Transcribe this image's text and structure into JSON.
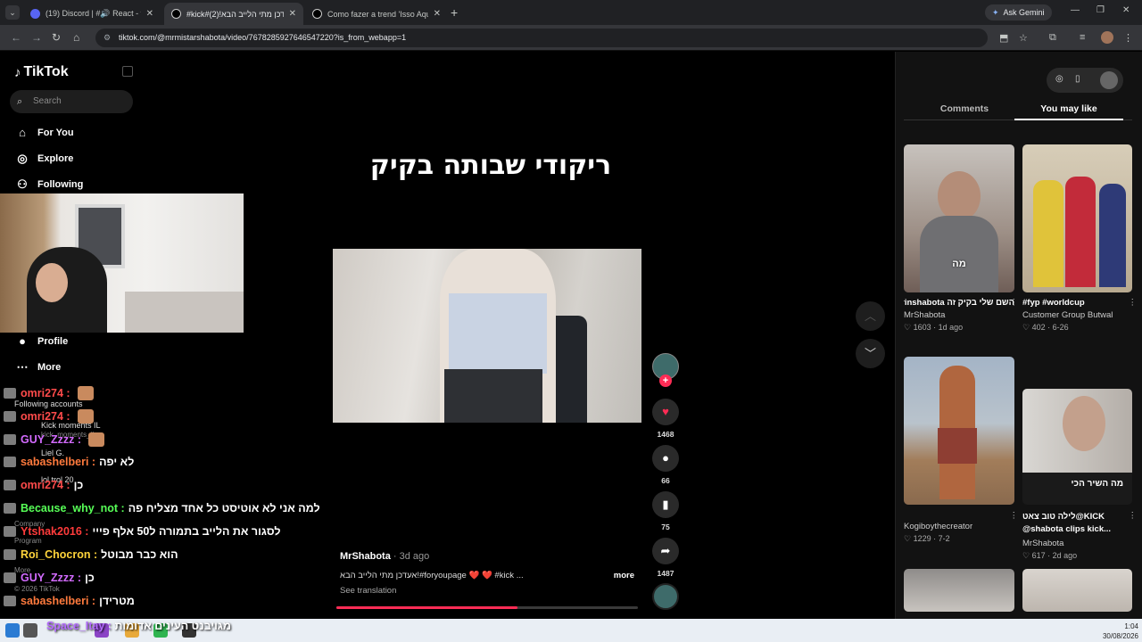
{
  "browser": {
    "tabs": [
      {
        "title": "(19) Discord | #🔊 React - t",
        "active": false,
        "favicon_color": "#5865f2"
      },
      {
        "title": "#kick#אעדכן מתי הלייב הבא!(2)",
        "active": true,
        "favicon_color": "#000000"
      },
      {
        "title": "Como fazer a trend 'Isso Aqui É",
        "active": false,
        "favicon_color": "#000000"
      }
    ],
    "url": "tiktok.com/@mrmistarshabota/video/7678285927646547220?is_from_webapp=1",
    "ask_gemini": "Ask Gemini"
  },
  "sidebar": {
    "logo": "TikTok",
    "search_placeholder": "Search",
    "nav": [
      {
        "label": "For You",
        "icon": "home-icon"
      },
      {
        "label": "Explore",
        "icon": "compass-icon"
      },
      {
        "label": "Following",
        "icon": "users-icon"
      },
      {
        "label": "Profile",
        "icon": "avatar-icon"
      },
      {
        "label": "More",
        "icon": "ellipsis-icon"
      }
    ],
    "following_header": "Following accounts",
    "following": [
      "Kick moments IL",
      "kick_moments_il",
      "Liel G.",
      "lol trol 20"
    ],
    "footer": [
      "Company",
      "Program",
      "More",
      "© 2026 TikTok"
    ]
  },
  "chat": [
    {
      "user": "omri274",
      "msg": "",
      "color": "#ff4b4b",
      "emote": true
    },
    {
      "user": "omri274",
      "msg": "",
      "color": "#ff4b4b",
      "emote": true
    },
    {
      "user": "GUY_Zzzz",
      "msg": "",
      "color": "#d36bff",
      "emote": true
    },
    {
      "user": "sabashelberi",
      "msg": "לא יפה",
      "color": "#ff7a3d",
      "emote": false
    },
    {
      "user": "omri274",
      "msg": "כן",
      "color": "#ff4b4b",
      "emote": false
    },
    {
      "user": "Because_why_not",
      "msg": "למה אני לא אוטיסט כל אחד מצליח פה",
      "color": "#57ff57",
      "emote": false
    },
    {
      "user": "Ytshak2016",
      "msg": "לסגור את הלייב בתמורה ל50 אלף פייי",
      "color": "#ff3b3b",
      "emote": false
    },
    {
      "user": "Roi_Chocron",
      "msg": "הוא כבר מבוטל",
      "color": "#ffd43b",
      "emote": false
    },
    {
      "user": "GUY_Zzzz",
      "msg": "כן",
      "color": "#d36bff",
      "emote": false
    },
    {
      "user": "sabashelberi",
      "msg": "מטרידן",
      "color": "#ff7a3d",
      "emote": false
    },
    {
      "user": "Space_Itay",
      "msg": "מגויבנט העינים אדומות",
      "color": "#b46bff",
      "emote": false
    }
  ],
  "video": {
    "title": "ריקודי שבותה בקיק",
    "author": "MrShabota",
    "ago": "· 3d ago",
    "caption": "אעדכן מתי הלייב הבא!#foryoupage ❤️ ❤️ #kick ...",
    "more": "more",
    "see_translation": "See translation",
    "likes": "1468",
    "comments": "66",
    "saves": "75",
    "shares": "1487",
    "progress": 0.6
  },
  "right_panel": {
    "tabs": [
      "Comments",
      "You may like"
    ],
    "cards": [
      {
        "title": "השם שלי בקיק זה Liorsorinshabota...",
        "author": "MrShabota",
        "likes": "1603",
        "date": "1d ago",
        "overlay": "מה"
      },
      {
        "title": "#fyp #worldcup",
        "author": "Customer Group Butwal",
        "likes": "402",
        "date": "6-26",
        "overlay": ""
      },
      {
        "title": "Kogiboythecreator",
        "author": "",
        "likes": "1229",
        "date": "7-2",
        "overlay": ""
      },
      {
        "title": "לילה טוב צאט@KICK @shabota clips kick...",
        "author": "MrShabota",
        "likes": "617",
        "date": "2d ago",
        "overlay": "מה השיר הכי"
      }
    ]
  },
  "taskbar": {
    "time": "1:04",
    "date": "30/08/2026"
  }
}
